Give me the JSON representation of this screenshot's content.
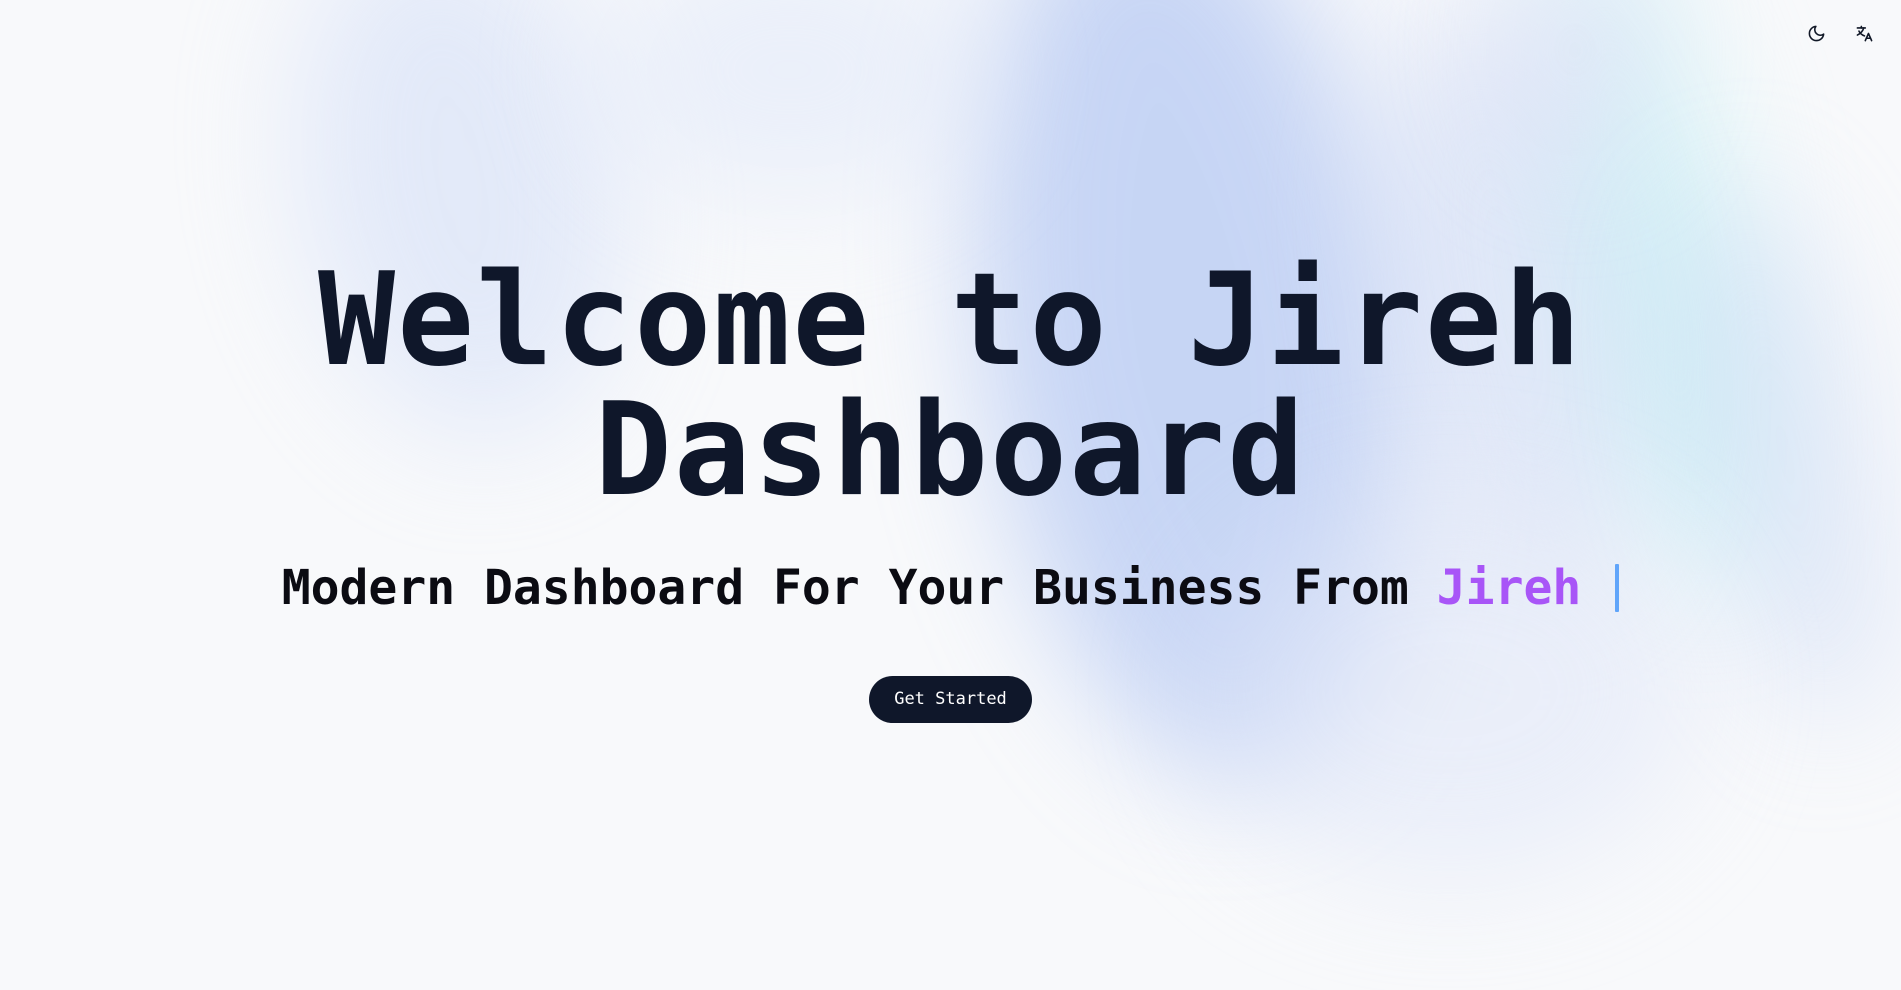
{
  "hero": {
    "title_line1": "Welcome to Jireh",
    "title_line2": "Dashboard",
    "subtitle_prefix": "Modern Dashboard For Your Business From",
    "subtitle_accent": "Jireh",
    "cta_label": "Get Started"
  },
  "topbar": {
    "icons": [
      "moon-icon",
      "translate-icon"
    ]
  },
  "colors": {
    "text": "#0f172a",
    "accent": "#a855f7",
    "cursor": "#60a5fa",
    "button_bg": "#0f172a",
    "button_text": "#ffffff"
  }
}
